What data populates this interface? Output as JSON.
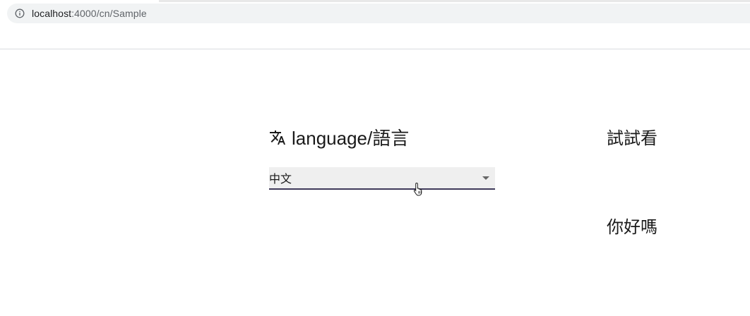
{
  "browser": {
    "url_host": "localhost",
    "url_rest": ":4000/cn/Sample",
    "info_icon": "info-icon"
  },
  "page": {
    "language_title": "language/語言",
    "title_icon": "translate-icon",
    "language_select": {
      "selected_value": "中文",
      "arrow_icon": "dropdown-arrow-icon"
    },
    "try_text": "試試看",
    "hello_text": "你好嗎"
  },
  "colors": {
    "address_bar_bg": "#f1f3f4",
    "select_bg": "#efefef",
    "select_underline": "#3f3a5a"
  }
}
